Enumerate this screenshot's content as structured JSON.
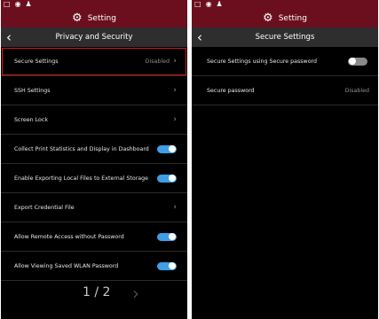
{
  "left": {
    "status_icons": [
      "monitor-icon",
      "location-icon",
      "person-icon"
    ],
    "app_title": "Setting",
    "page_title": "Privacy and Security",
    "items": [
      {
        "label": "Secure Settings",
        "value": "Disabled",
        "control": "chevron",
        "selected": true
      },
      {
        "label": "SSH Settings",
        "control": "chevron"
      },
      {
        "label": "Screen Lock",
        "control": "chevron"
      },
      {
        "label": "Collect Print Statistics and Display in Dashboard",
        "control": "toggle",
        "state": "on"
      },
      {
        "label": "Enable Exporting Local Files to External Storage",
        "control": "toggle",
        "state": "on"
      },
      {
        "label": "Export Credential File",
        "control": "chevron"
      },
      {
        "label": "Allow Remote Access without Password",
        "control": "toggle",
        "state": "on"
      },
      {
        "label": "Allow Viewing Saved WLAN Password",
        "control": "toggle",
        "state": "on"
      }
    ],
    "pager": {
      "text": "1 / 2"
    }
  },
  "right": {
    "status_icons": [
      "monitor-icon",
      "location-icon",
      "person-icon"
    ],
    "app_title": "Setting",
    "page_title": "Secure Settings",
    "items": [
      {
        "label": "Secure Settings using Secure password",
        "control": "toggle",
        "state": "off"
      },
      {
        "label": "Secure password",
        "value": "Disabled",
        "control": "none"
      }
    ]
  },
  "colors": {
    "header": "#6b0f1e",
    "subheader": "#2e2e2e",
    "toggle_on": "#3e9ee8",
    "toggle_off": "#8a8a8a",
    "selection_outline": "#d01818"
  }
}
